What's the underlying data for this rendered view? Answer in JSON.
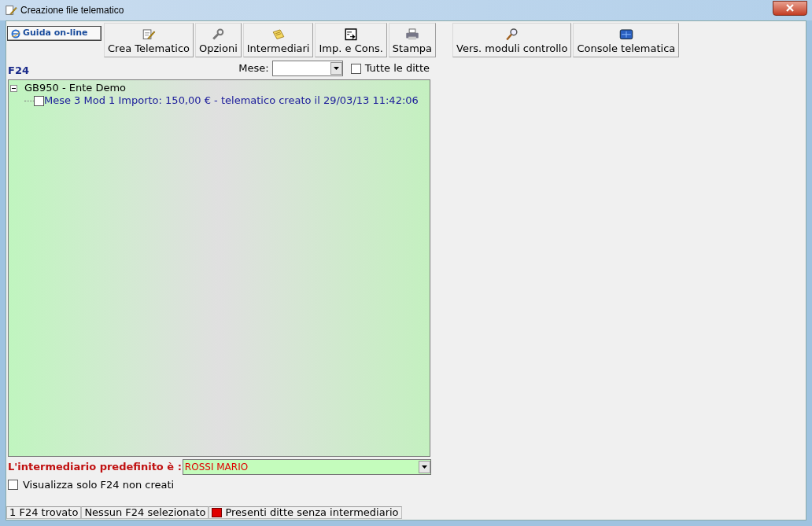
{
  "window": {
    "title": "Creazione file telematico"
  },
  "help_button": {
    "label": "Guida on-line"
  },
  "toolbar": [
    {
      "label": "Crea Telematico",
      "kind": "create",
      "group_start": false
    },
    {
      "label": "Opzioni",
      "kind": "options",
      "group_start": false
    },
    {
      "label": "Intermediari",
      "kind": "notes",
      "group_start": false
    },
    {
      "label": "Imp. e Cons.",
      "kind": "import",
      "group_start": false
    },
    {
      "label": "Stampa",
      "kind": "print",
      "group_start": false
    },
    {
      "label": "Vers. moduli controllo",
      "kind": "search",
      "group_start": true
    },
    {
      "label": "Console telematica",
      "kind": "console",
      "group_start": false
    }
  ],
  "section_label": "F24",
  "month_filter": {
    "label": "Mese:"
  },
  "all_companies": {
    "label": "Tutte le ditte",
    "checked": false
  },
  "tree": [
    {
      "label": "GB950 - Ente Demo",
      "expanded": true,
      "children": [
        {
          "label": "Mese 3 Mod 1 Importo: 150,00 € - telematico creato il 29/03/13 11:42:06",
          "checked": false
        }
      ]
    }
  ],
  "default_intermediary": {
    "label": "L'intermediario predefinito è :",
    "value": "ROSSI MARIO"
  },
  "only_not_created": {
    "label": "Visualizza solo F24 non creati",
    "checked": false
  },
  "status_bar": [
    {
      "text": "1 F24 trovato",
      "flag": false
    },
    {
      "text": "Nessun F24 selezionato",
      "flag": false
    },
    {
      "text": "Presenti ditte senza intermediario",
      "flag": true
    }
  ]
}
